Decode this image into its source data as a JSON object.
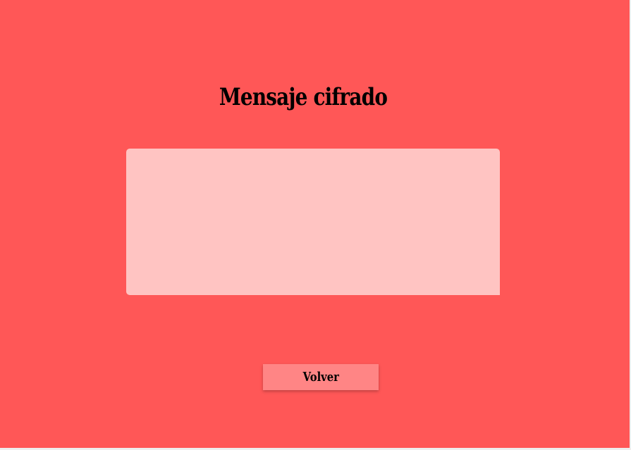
{
  "page": {
    "title": "Mensaje cifrado",
    "message": {
      "value": "",
      "placeholder": ""
    },
    "back_button_label": "Volver"
  },
  "colors": {
    "background": "#ff5757",
    "textarea": "#ffc4c2",
    "button": "#ff8585",
    "text": "#000000"
  }
}
